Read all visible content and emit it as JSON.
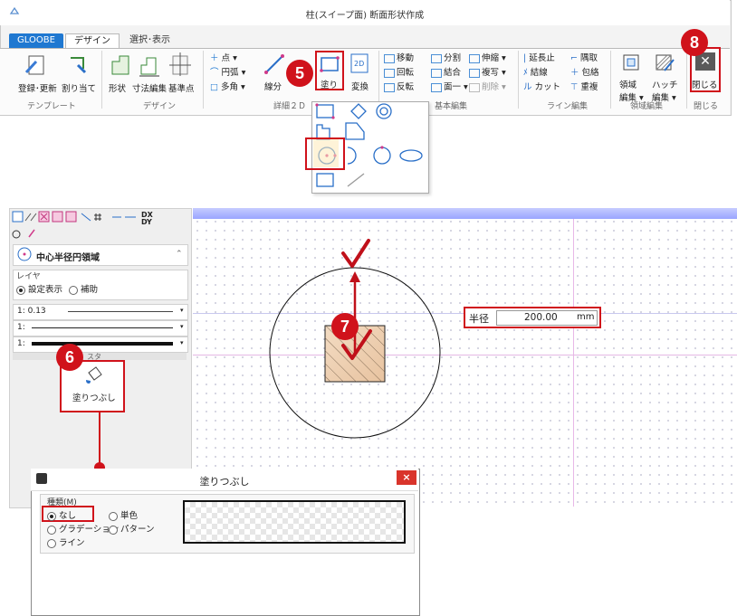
{
  "window": {
    "title": "柱(スイープ面) 断面形状作成"
  },
  "tabs": [
    {
      "label": "GLOOBE"
    },
    {
      "label": "デザイン"
    },
    {
      "label": "選択･表示"
    }
  ],
  "ribbon": {
    "template": {
      "register_label": "登録･更新",
      "assign_label": "割り当て",
      "group_label": "テンプレート"
    },
    "design": {
      "shape_label": "形状",
      "dim_edit_label": "寸法編集",
      "base_point_label": "基準点",
      "group_label": "デザイン"
    },
    "detail2d": {
      "point_label": "点",
      "arc_label": "円弧",
      "polygon_label": "多角",
      "segment_label": "線分",
      "fill_label": "塗り",
      "convert_label": "変換",
      "group_label": "詳細２Ｄ"
    },
    "basic_edit": {
      "move_label": "移動",
      "rotate_label": "回転",
      "flip_label": "反転",
      "split_label": "分割",
      "join_label": "結合",
      "face_label": "面一",
      "stretch_label": "伸縮",
      "copy_label": "複写",
      "delete_label": "削除",
      "group_label": "基本編集"
    },
    "line_edit": {
      "extend_label": "延長止",
      "knot_label": "結線",
      "cut_label": "カット",
      "corner_label": "隅取",
      "wrap_label": "包絡",
      "overlap_label": "重複",
      "group_label": "ライン編集"
    },
    "region_edit": {
      "region_label": "領域",
      "region_edit_label": "編集",
      "hatch_label": "ハッチ",
      "hatch_edit_label": "編集",
      "group_label": "領域編集"
    },
    "close": {
      "close_label": "閉じる",
      "group_label": "閉じる"
    }
  },
  "badges": {
    "b5": "5",
    "b6": "6",
    "b7": "7",
    "b8": "8"
  },
  "toolbar2": {
    "dx_label": "DX\nDY"
  },
  "panel": {
    "mode_title": "中心半径円領域",
    "layer_label": "レイヤ",
    "layer_opt1": "設定表示",
    "layer_opt2": "補助",
    "line_width": "1: 0.13",
    "line_type": "1:",
    "line_color": "1:",
    "section_label": "スタ",
    "fill_button_label": "塗りつぶし"
  },
  "radius": {
    "label": "半径",
    "value": "200.00",
    "unit": "mm"
  },
  "dialog": {
    "title": "塗りつぶし",
    "type_label": "種類(M)",
    "opt_none": "なし",
    "opt_single": "単色",
    "opt_gradation": "グラデーション",
    "opt_pattern": "パターン",
    "opt_line": "ライン",
    "close_glyph": "×"
  },
  "colors": {
    "badge_red": "#d0121b",
    "accent_blue": "#1f78d1",
    "canvas_bar": "#9aa5ff"
  }
}
